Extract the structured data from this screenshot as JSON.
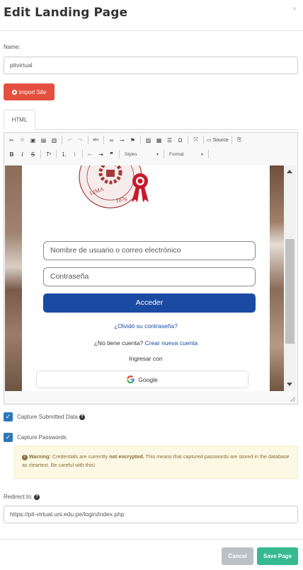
{
  "modal": {
    "title": "Edit Landing Page",
    "close": "×"
  },
  "name_field": {
    "label": "Name:",
    "value": "pitvirtual"
  },
  "import_button": {
    "label": "Import Site"
  },
  "tabs": [
    {
      "label": "HTML"
    }
  ],
  "toolbar": {
    "source_label": "Source",
    "styles_label": "Styles",
    "format_label": "Format"
  },
  "preview": {
    "seal_text": "LIMA 1876",
    "username_placeholder": "Nombre de usuario o correo electrónico",
    "password_placeholder": "Contraseña",
    "login_button": "Acceder",
    "forgot_link": "¿Olvidó su contraseña?",
    "no_account_text": "¿No tiene cuenta?",
    "create_account_link": "Crear nueva cuenta",
    "login_with": "Ingresar con",
    "google_button": "Google"
  },
  "capture_data": {
    "label": "Capture Submitted Data",
    "checked": true
  },
  "capture_passwords": {
    "label": "Capture Passwords",
    "checked": true
  },
  "warning": {
    "title": "Warning:",
    "text1": "Credentials are currently",
    "emphasis": "not encrypted.",
    "text2": "This means that captured passwords are stored in the database as cleartext. Be careful with this!"
  },
  "redirect": {
    "label": "Redirect to:",
    "value": "https://pit-virtual.uni.edu.pe/login/index.php"
  },
  "footer": {
    "cancel_label": "Cancel",
    "save_label": "Save Page"
  },
  "colors": {
    "import": "#e4503f",
    "checkbox": "#2e76b8",
    "save": "#37b98f",
    "cancel": "#bcc1c6",
    "login_button": "#1a4aa1"
  }
}
